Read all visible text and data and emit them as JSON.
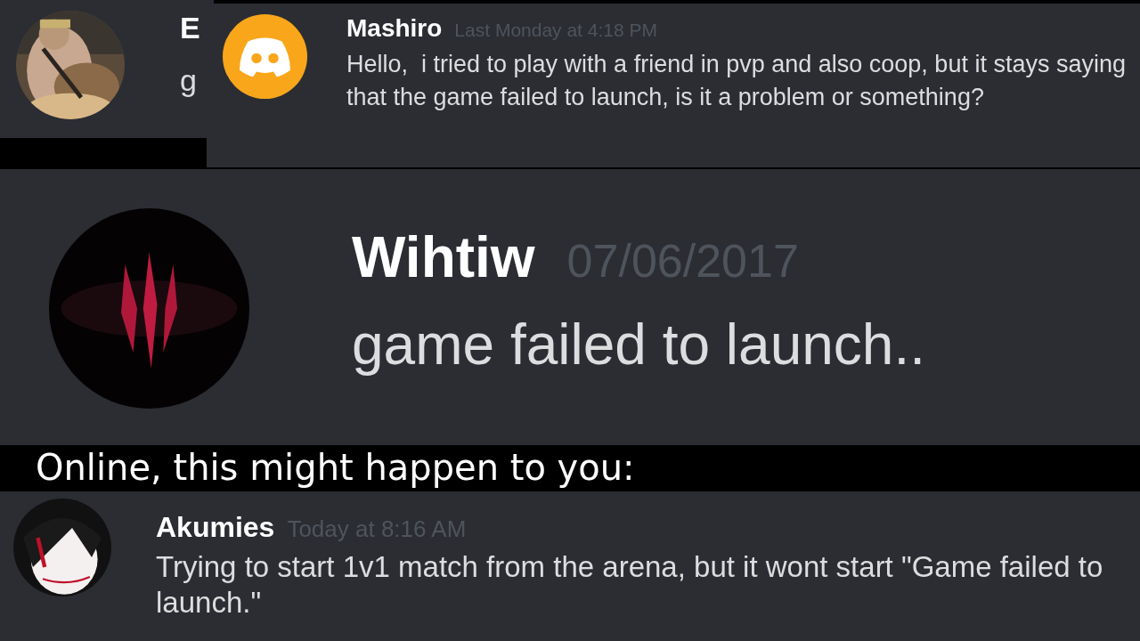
{
  "messages": [
    {
      "author": "E",
      "text": "g"
    },
    {
      "avatar": {
        "kind": "logo"
      },
      "author": "Mashiro",
      "time": "Last Monday at 4:18 PM",
      "text": "Hello,  i tried to play with a friend in pvp and also coop, but it stays saying that the game failed to launch, is it a problem or something?"
    },
    {
      "avatar": {
        "kind": "emblem"
      },
      "author": "Wihtiw",
      "time": "07/06/2017",
      "text": "game failed to launch.."
    },
    {
      "avatar": {
        "kind": "drawing"
      },
      "author": "Akumies",
      "time": "Today at 8:16 AM",
      "text": "Trying to start 1v1 match from the arena, but it wont start \"Game failed to launch.\""
    }
  ],
  "caption": "Online, this might happen to you:"
}
